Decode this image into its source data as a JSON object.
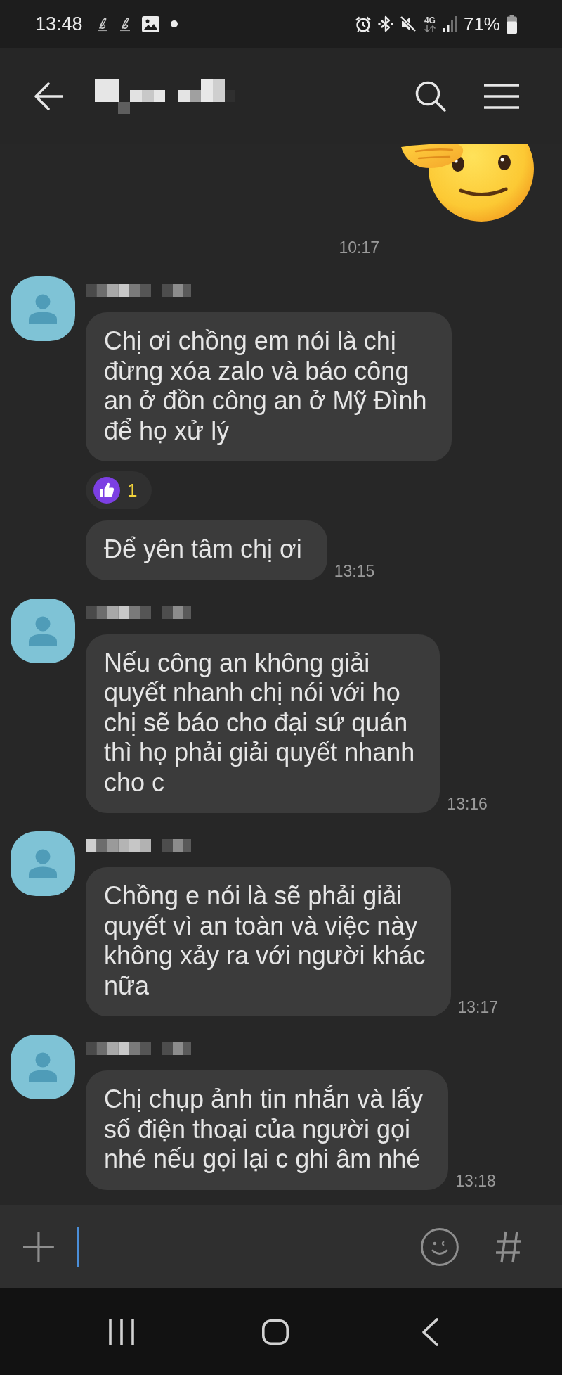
{
  "status_bar": {
    "time": "13:48",
    "network": "4G",
    "battery": "71%"
  },
  "messages": [
    {
      "kind": "sticker",
      "time": "10:17"
    },
    {
      "kind": "text",
      "sender_shown": true,
      "lines": [
        "Chị ơi chồng em nói là chị",
        "đừng xóa zalo và báo công",
        "an ở đồn công an ở Mỹ Đình",
        "để họ xử lý"
      ],
      "reaction": {
        "count": "1"
      }
    },
    {
      "kind": "text",
      "sender_shown": false,
      "lines": [
        "Để yên tâm chị ơi"
      ],
      "time": "13:15"
    },
    {
      "kind": "text",
      "sender_shown": true,
      "lines": [
        "Nếu công an không giải",
        "quyết nhanh chị nói với họ",
        "chị sẽ báo cho đại sứ quán",
        "thì họ phải giải quyết nhanh",
        "cho c"
      ],
      "time": "13:16"
    },
    {
      "kind": "text",
      "sender_shown": true,
      "lines": [
        "Chồng e nói là sẽ phải giải",
        "quyết vì an toàn và việc này",
        "không xảy ra với người khác",
        "nữa"
      ],
      "time": "13:17"
    },
    {
      "kind": "text",
      "sender_shown": true,
      "lines": [
        "Chị chụp ảnh tin nhắn và lấy",
        "số điện thoại của người gọi",
        "nhé nếu gọi lại c ghi âm nhé"
      ],
      "time": "13:18"
    }
  ],
  "composer": {
    "focused": true
  }
}
